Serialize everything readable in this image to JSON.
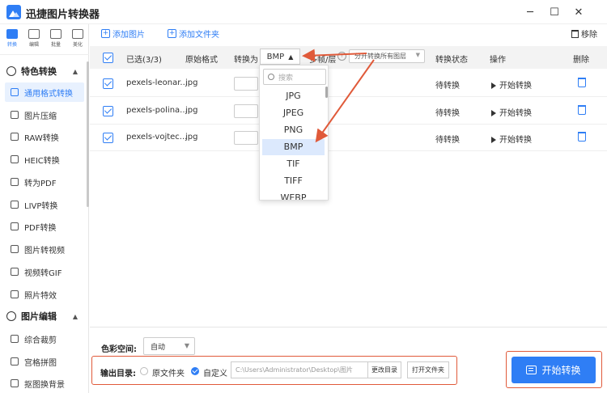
{
  "app": {
    "title": "迅捷图片转换器"
  },
  "window_controls": {
    "minimize": "─",
    "maximize": "☐",
    "close": "✕"
  },
  "modes": [
    {
      "label": "转换",
      "active": true
    },
    {
      "label": "编辑",
      "active": false
    },
    {
      "label": "批量",
      "active": false
    },
    {
      "label": "美化",
      "active": false
    }
  ],
  "sidebar": {
    "sections": [
      {
        "title": "特色转换",
        "items": [
          {
            "label": "通用格式转换",
            "active": true
          },
          {
            "label": "图片压缩"
          },
          {
            "label": "RAW转换"
          },
          {
            "label": "HEIC转换"
          },
          {
            "label": "转为PDF"
          },
          {
            "label": "LIVP转换"
          },
          {
            "label": "PDF转换"
          },
          {
            "label": "图片转视频"
          },
          {
            "label": "视频转GIF"
          },
          {
            "label": "照片特效"
          }
        ]
      },
      {
        "title": "图片编辑",
        "items": [
          {
            "label": "综合裁剪"
          },
          {
            "label": "宫格拼图"
          },
          {
            "label": "抠图换背景"
          }
        ]
      }
    ]
  },
  "toolbar": {
    "add_image": "添加图片",
    "add_folder": "添加文件夹",
    "remove": "移除"
  },
  "table": {
    "headers": {
      "selected": "已选(3/3)",
      "original_format": "原始格式",
      "convert_to": "转换为",
      "convert_to_value": "BMP",
      "layers": "多帧/层",
      "layers_help": "?",
      "layers_option": "分开转换所有图层",
      "status": "转换状态",
      "action": "操作",
      "delete": "删除"
    },
    "rows": [
      {
        "name": "pexels-leonar...",
        "format": "jpg",
        "status": "待转换",
        "action": "开始转换"
      },
      {
        "name": "pexels-polina...",
        "format": "jpg",
        "status": "待转换",
        "action": "开始转换"
      },
      {
        "name": "pexels-vojtec...",
        "format": "jpg",
        "status": "待转换",
        "action": "开始转换"
      }
    ]
  },
  "dropdown": {
    "search_placeholder": "搜索",
    "options": [
      "JPG",
      "JPEG",
      "PNG",
      "BMP",
      "TIF",
      "TIFF",
      "WEBP"
    ],
    "selected": "BMP"
  },
  "bottom": {
    "color_space_label": "色彩空间:",
    "color_space_value": "自动",
    "output_label": "输出目录:",
    "option_original": "原文件夹",
    "option_custom": "自定义",
    "path": "C:\\Users\\Administrator\\Desktop\\图片",
    "change_dir": "更改目录",
    "open_folder": "打开文件夹",
    "start": "开始转换"
  },
  "colors": {
    "accent": "#2f7ef5",
    "annotation": "#e05a3a"
  }
}
